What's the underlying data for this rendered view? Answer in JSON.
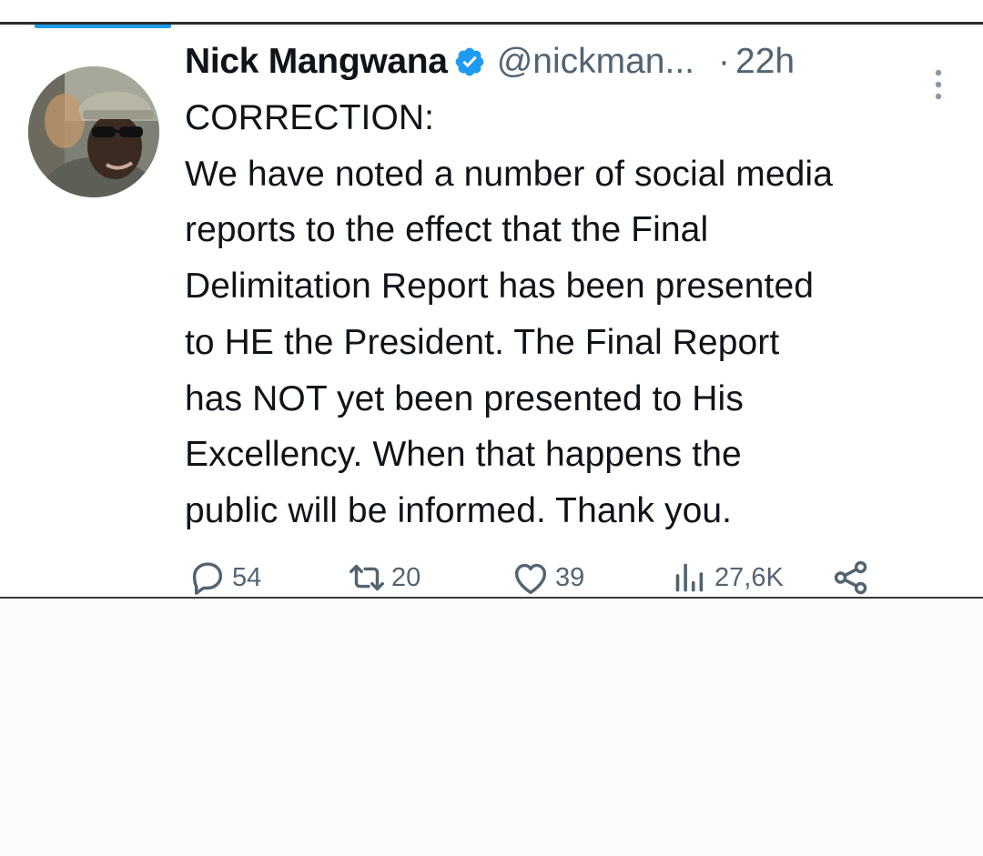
{
  "tweet": {
    "author": {
      "display_name": "Nick Mangwana",
      "handle": "@nickman...",
      "verified_icon": "verified-badge-icon",
      "avatar": "profile-photo"
    },
    "separator": "·",
    "time": "22h",
    "more_icon": "vertical-ellipsis-icon",
    "text_lines": [
      "CORRECTION:",
      "We have noted a number of social media",
      "reports to the effect that the Final",
      "Delimitation Report has been presented",
      "to HE the President. The Final Report",
      "has NOT yet been presented to His",
      "Excellency. When that happens the",
      "public will be informed. Thank you."
    ],
    "actions": {
      "replies": "54",
      "retweets": "20",
      "likes": "39",
      "views": "27,6K",
      "share_icon": "share-icon"
    }
  },
  "colors": {
    "text": "#0f1419",
    "secondary": "#536471",
    "verified": "#1d9bf0",
    "accent": "#1d9bf0"
  }
}
